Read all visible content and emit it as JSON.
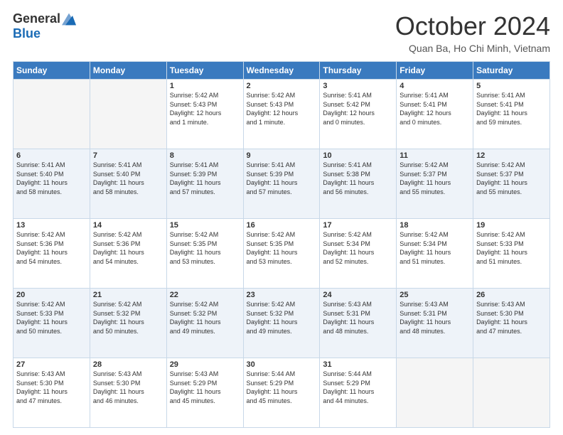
{
  "logo": {
    "general": "General",
    "blue": "Blue"
  },
  "title": "October 2024",
  "location": "Quan Ba, Ho Chi Minh, Vietnam",
  "headers": [
    "Sunday",
    "Monday",
    "Tuesday",
    "Wednesday",
    "Thursday",
    "Friday",
    "Saturday"
  ],
  "weeks": [
    [
      {
        "day": "",
        "info": ""
      },
      {
        "day": "",
        "info": ""
      },
      {
        "day": "1",
        "info": "Sunrise: 5:42 AM\nSunset: 5:43 PM\nDaylight: 12 hours\nand 1 minute."
      },
      {
        "day": "2",
        "info": "Sunrise: 5:42 AM\nSunset: 5:43 PM\nDaylight: 12 hours\nand 1 minute."
      },
      {
        "day": "3",
        "info": "Sunrise: 5:41 AM\nSunset: 5:42 PM\nDaylight: 12 hours\nand 0 minutes."
      },
      {
        "day": "4",
        "info": "Sunrise: 5:41 AM\nSunset: 5:41 PM\nDaylight: 12 hours\nand 0 minutes."
      },
      {
        "day": "5",
        "info": "Sunrise: 5:41 AM\nSunset: 5:41 PM\nDaylight: 11 hours\nand 59 minutes."
      }
    ],
    [
      {
        "day": "6",
        "info": "Sunrise: 5:41 AM\nSunset: 5:40 PM\nDaylight: 11 hours\nand 58 minutes."
      },
      {
        "day": "7",
        "info": "Sunrise: 5:41 AM\nSunset: 5:40 PM\nDaylight: 11 hours\nand 58 minutes."
      },
      {
        "day": "8",
        "info": "Sunrise: 5:41 AM\nSunset: 5:39 PM\nDaylight: 11 hours\nand 57 minutes."
      },
      {
        "day": "9",
        "info": "Sunrise: 5:41 AM\nSunset: 5:39 PM\nDaylight: 11 hours\nand 57 minutes."
      },
      {
        "day": "10",
        "info": "Sunrise: 5:41 AM\nSunset: 5:38 PM\nDaylight: 11 hours\nand 56 minutes."
      },
      {
        "day": "11",
        "info": "Sunrise: 5:42 AM\nSunset: 5:37 PM\nDaylight: 11 hours\nand 55 minutes."
      },
      {
        "day": "12",
        "info": "Sunrise: 5:42 AM\nSunset: 5:37 PM\nDaylight: 11 hours\nand 55 minutes."
      }
    ],
    [
      {
        "day": "13",
        "info": "Sunrise: 5:42 AM\nSunset: 5:36 PM\nDaylight: 11 hours\nand 54 minutes."
      },
      {
        "day": "14",
        "info": "Sunrise: 5:42 AM\nSunset: 5:36 PM\nDaylight: 11 hours\nand 54 minutes."
      },
      {
        "day": "15",
        "info": "Sunrise: 5:42 AM\nSunset: 5:35 PM\nDaylight: 11 hours\nand 53 minutes."
      },
      {
        "day": "16",
        "info": "Sunrise: 5:42 AM\nSunset: 5:35 PM\nDaylight: 11 hours\nand 53 minutes."
      },
      {
        "day": "17",
        "info": "Sunrise: 5:42 AM\nSunset: 5:34 PM\nDaylight: 11 hours\nand 52 minutes."
      },
      {
        "day": "18",
        "info": "Sunrise: 5:42 AM\nSunset: 5:34 PM\nDaylight: 11 hours\nand 51 minutes."
      },
      {
        "day": "19",
        "info": "Sunrise: 5:42 AM\nSunset: 5:33 PM\nDaylight: 11 hours\nand 51 minutes."
      }
    ],
    [
      {
        "day": "20",
        "info": "Sunrise: 5:42 AM\nSunset: 5:33 PM\nDaylight: 11 hours\nand 50 minutes."
      },
      {
        "day": "21",
        "info": "Sunrise: 5:42 AM\nSunset: 5:32 PM\nDaylight: 11 hours\nand 50 minutes."
      },
      {
        "day": "22",
        "info": "Sunrise: 5:42 AM\nSunset: 5:32 PM\nDaylight: 11 hours\nand 49 minutes."
      },
      {
        "day": "23",
        "info": "Sunrise: 5:42 AM\nSunset: 5:32 PM\nDaylight: 11 hours\nand 49 minutes."
      },
      {
        "day": "24",
        "info": "Sunrise: 5:43 AM\nSunset: 5:31 PM\nDaylight: 11 hours\nand 48 minutes."
      },
      {
        "day": "25",
        "info": "Sunrise: 5:43 AM\nSunset: 5:31 PM\nDaylight: 11 hours\nand 48 minutes."
      },
      {
        "day": "26",
        "info": "Sunrise: 5:43 AM\nSunset: 5:30 PM\nDaylight: 11 hours\nand 47 minutes."
      }
    ],
    [
      {
        "day": "27",
        "info": "Sunrise: 5:43 AM\nSunset: 5:30 PM\nDaylight: 11 hours\nand 47 minutes."
      },
      {
        "day": "28",
        "info": "Sunrise: 5:43 AM\nSunset: 5:30 PM\nDaylight: 11 hours\nand 46 minutes."
      },
      {
        "day": "29",
        "info": "Sunrise: 5:43 AM\nSunset: 5:29 PM\nDaylight: 11 hours\nand 45 minutes."
      },
      {
        "day": "30",
        "info": "Sunrise: 5:44 AM\nSunset: 5:29 PM\nDaylight: 11 hours\nand 45 minutes."
      },
      {
        "day": "31",
        "info": "Sunrise: 5:44 AM\nSunset: 5:29 PM\nDaylight: 11 hours\nand 44 minutes."
      },
      {
        "day": "",
        "info": ""
      },
      {
        "day": "",
        "info": ""
      }
    ]
  ]
}
